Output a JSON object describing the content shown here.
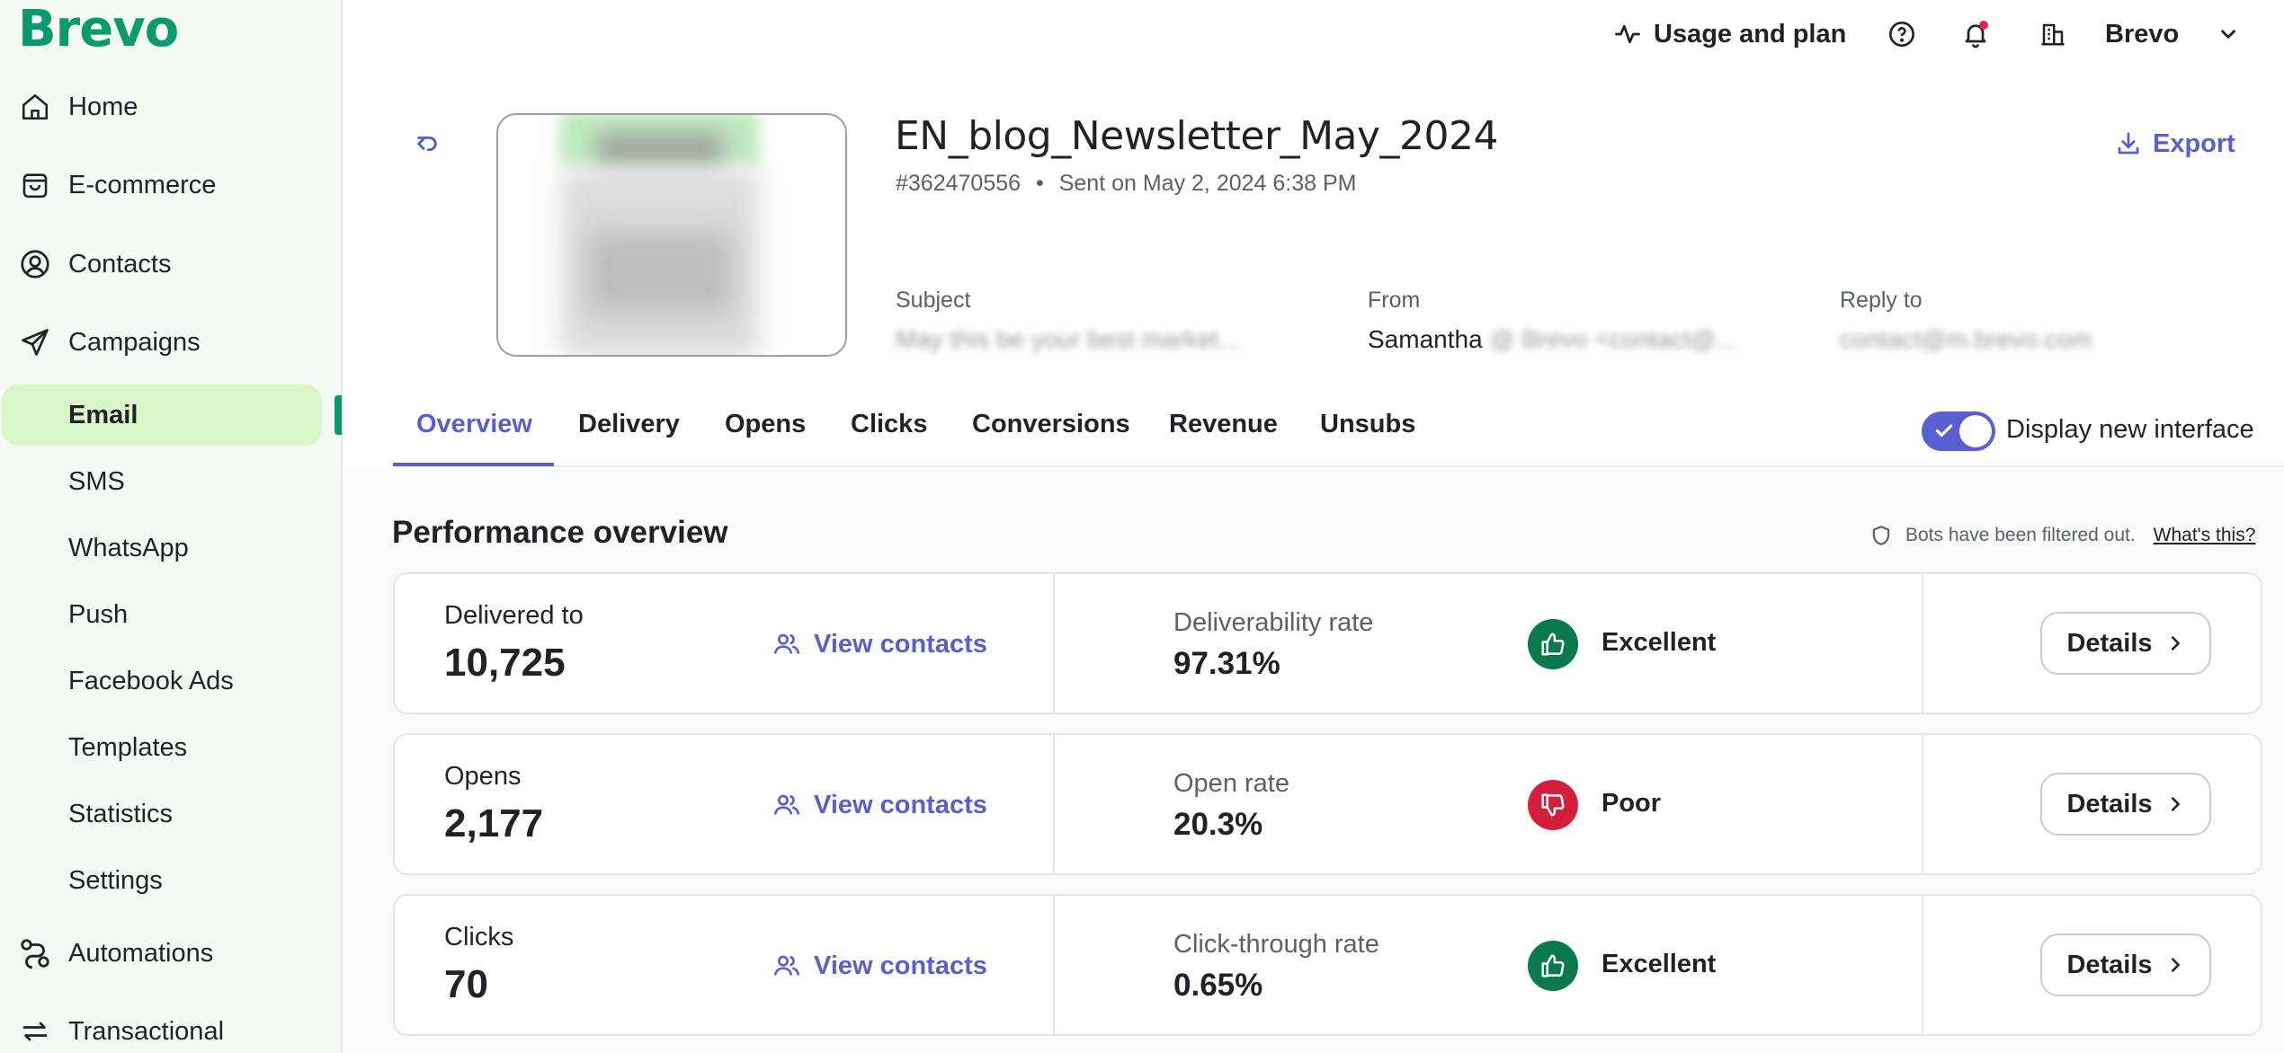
{
  "brand": {
    "logo": "Brevo",
    "accent": "#0b996e",
    "primary": "#5a5fcf"
  },
  "sidebar": {
    "items": [
      {
        "label": "Home",
        "icon": "home-icon"
      },
      {
        "label": "E-commerce",
        "icon": "shopping-bag-icon"
      },
      {
        "label": "Contacts",
        "icon": "contact-circle-icon"
      },
      {
        "label": "Campaigns",
        "icon": "paper-plane-icon"
      }
    ],
    "campaign_subitems": [
      "Email",
      "SMS",
      "WhatsApp",
      "Push",
      "Facebook Ads",
      "Templates",
      "Statistics",
      "Settings"
    ],
    "active_subitem": "Email",
    "bottom_items": [
      {
        "label": "Automations",
        "icon": "automation-icon"
      },
      {
        "label": "Transactional",
        "icon": "arrows-swap-icon"
      }
    ]
  },
  "topbar": {
    "usage_label": "Usage and plan",
    "account_label": "Brevo"
  },
  "campaign": {
    "title": "EN_blog_Newsletter_May_2024",
    "id": "#362470556",
    "separator": "•",
    "sent": "Sent on May 2, 2024 6:38 PM",
    "subject_label": "Subject",
    "subject_value": "May this be your best market...",
    "from_label": "From",
    "from_name": "Samantha",
    "from_email": "@ Brevo <contact@...",
    "reply_label": "Reply to",
    "reply_value": "contact@m.brevo.com",
    "export_label": "Export"
  },
  "tabs": {
    "items": [
      "Overview",
      "Delivery",
      "Opens",
      "Clicks",
      "Conversions",
      "Revenue",
      "Unsubs"
    ],
    "active": "Overview",
    "toggle_label": "Display new interface",
    "toggle_on": true
  },
  "overview": {
    "title": "Performance overview",
    "bots_note": "Bots have been filtered out.",
    "bots_link": "What's this?",
    "rows": [
      {
        "label": "Delivered to",
        "value": "10,725",
        "view_label": "View contacts",
        "rate_label": "Deliverability rate",
        "rate_value": "97.31%",
        "quality": "Excellent",
        "quality_type": "good",
        "details_label": "Details"
      },
      {
        "label": "Opens",
        "value": "2,177",
        "view_label": "View contacts",
        "rate_label": "Open rate",
        "rate_value": "20.3%",
        "quality": "Poor",
        "quality_type": "bad",
        "details_label": "Details"
      },
      {
        "label": "Clicks",
        "value": "70",
        "view_label": "View contacts",
        "rate_label": "Click-through rate",
        "rate_value": "0.65%",
        "quality": "Excellent",
        "quality_type": "good",
        "details_label": "Details"
      }
    ]
  }
}
